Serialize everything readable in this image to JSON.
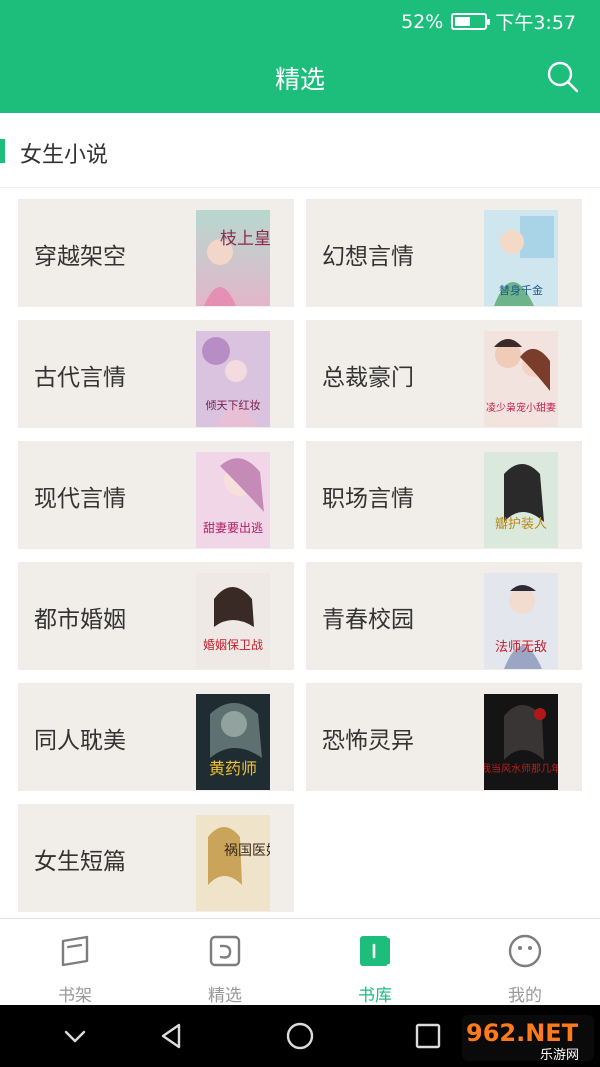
{
  "status_bar": {
    "battery": "52%",
    "time": "下午3:57",
    "battery_level": 0.52
  },
  "header": {
    "title": "精选"
  },
  "section": {
    "title": "女生小说"
  },
  "categories": [
    {
      "name": "穿越架空",
      "cover_text": "枝上皇后"
    },
    {
      "name": "幻想言情",
      "cover_text": "替身千金"
    },
    {
      "name": "古代言情",
      "cover_text": "倾天下红妆"
    },
    {
      "name": "总裁豪门",
      "cover_text": "凌少枭宠小甜妻"
    },
    {
      "name": "现代言情",
      "cover_text": "甜妻要出逃"
    },
    {
      "name": "职场言情",
      "cover_text": "瓣护装人"
    },
    {
      "name": "都市婚姻",
      "cover_text": "婚姻保卫战"
    },
    {
      "name": "青春校园",
      "cover_text": "法师无敌"
    },
    {
      "name": "同人耽美",
      "cover_text": "黄药师"
    },
    {
      "name": "恐怖灵异",
      "cover_text": "我当风水师那几年"
    },
    {
      "name": "女生短篇",
      "cover_text": "祸国医妃"
    }
  ],
  "tabs": [
    {
      "label": "书架",
      "icon": "bookshelf-icon",
      "active": false
    },
    {
      "label": "精选",
      "icon": "featured-icon",
      "active": false
    },
    {
      "label": "书库",
      "icon": "library-icon",
      "active": true
    },
    {
      "label": "我的",
      "icon": "profile-icon",
      "active": false
    }
  ],
  "watermark": {
    "text": "962.NET",
    "subtext": "乐游网"
  },
  "colors": {
    "brand": "#1dbd7c",
    "card_bg": "#f1eeea",
    "inactive": "#999999"
  }
}
